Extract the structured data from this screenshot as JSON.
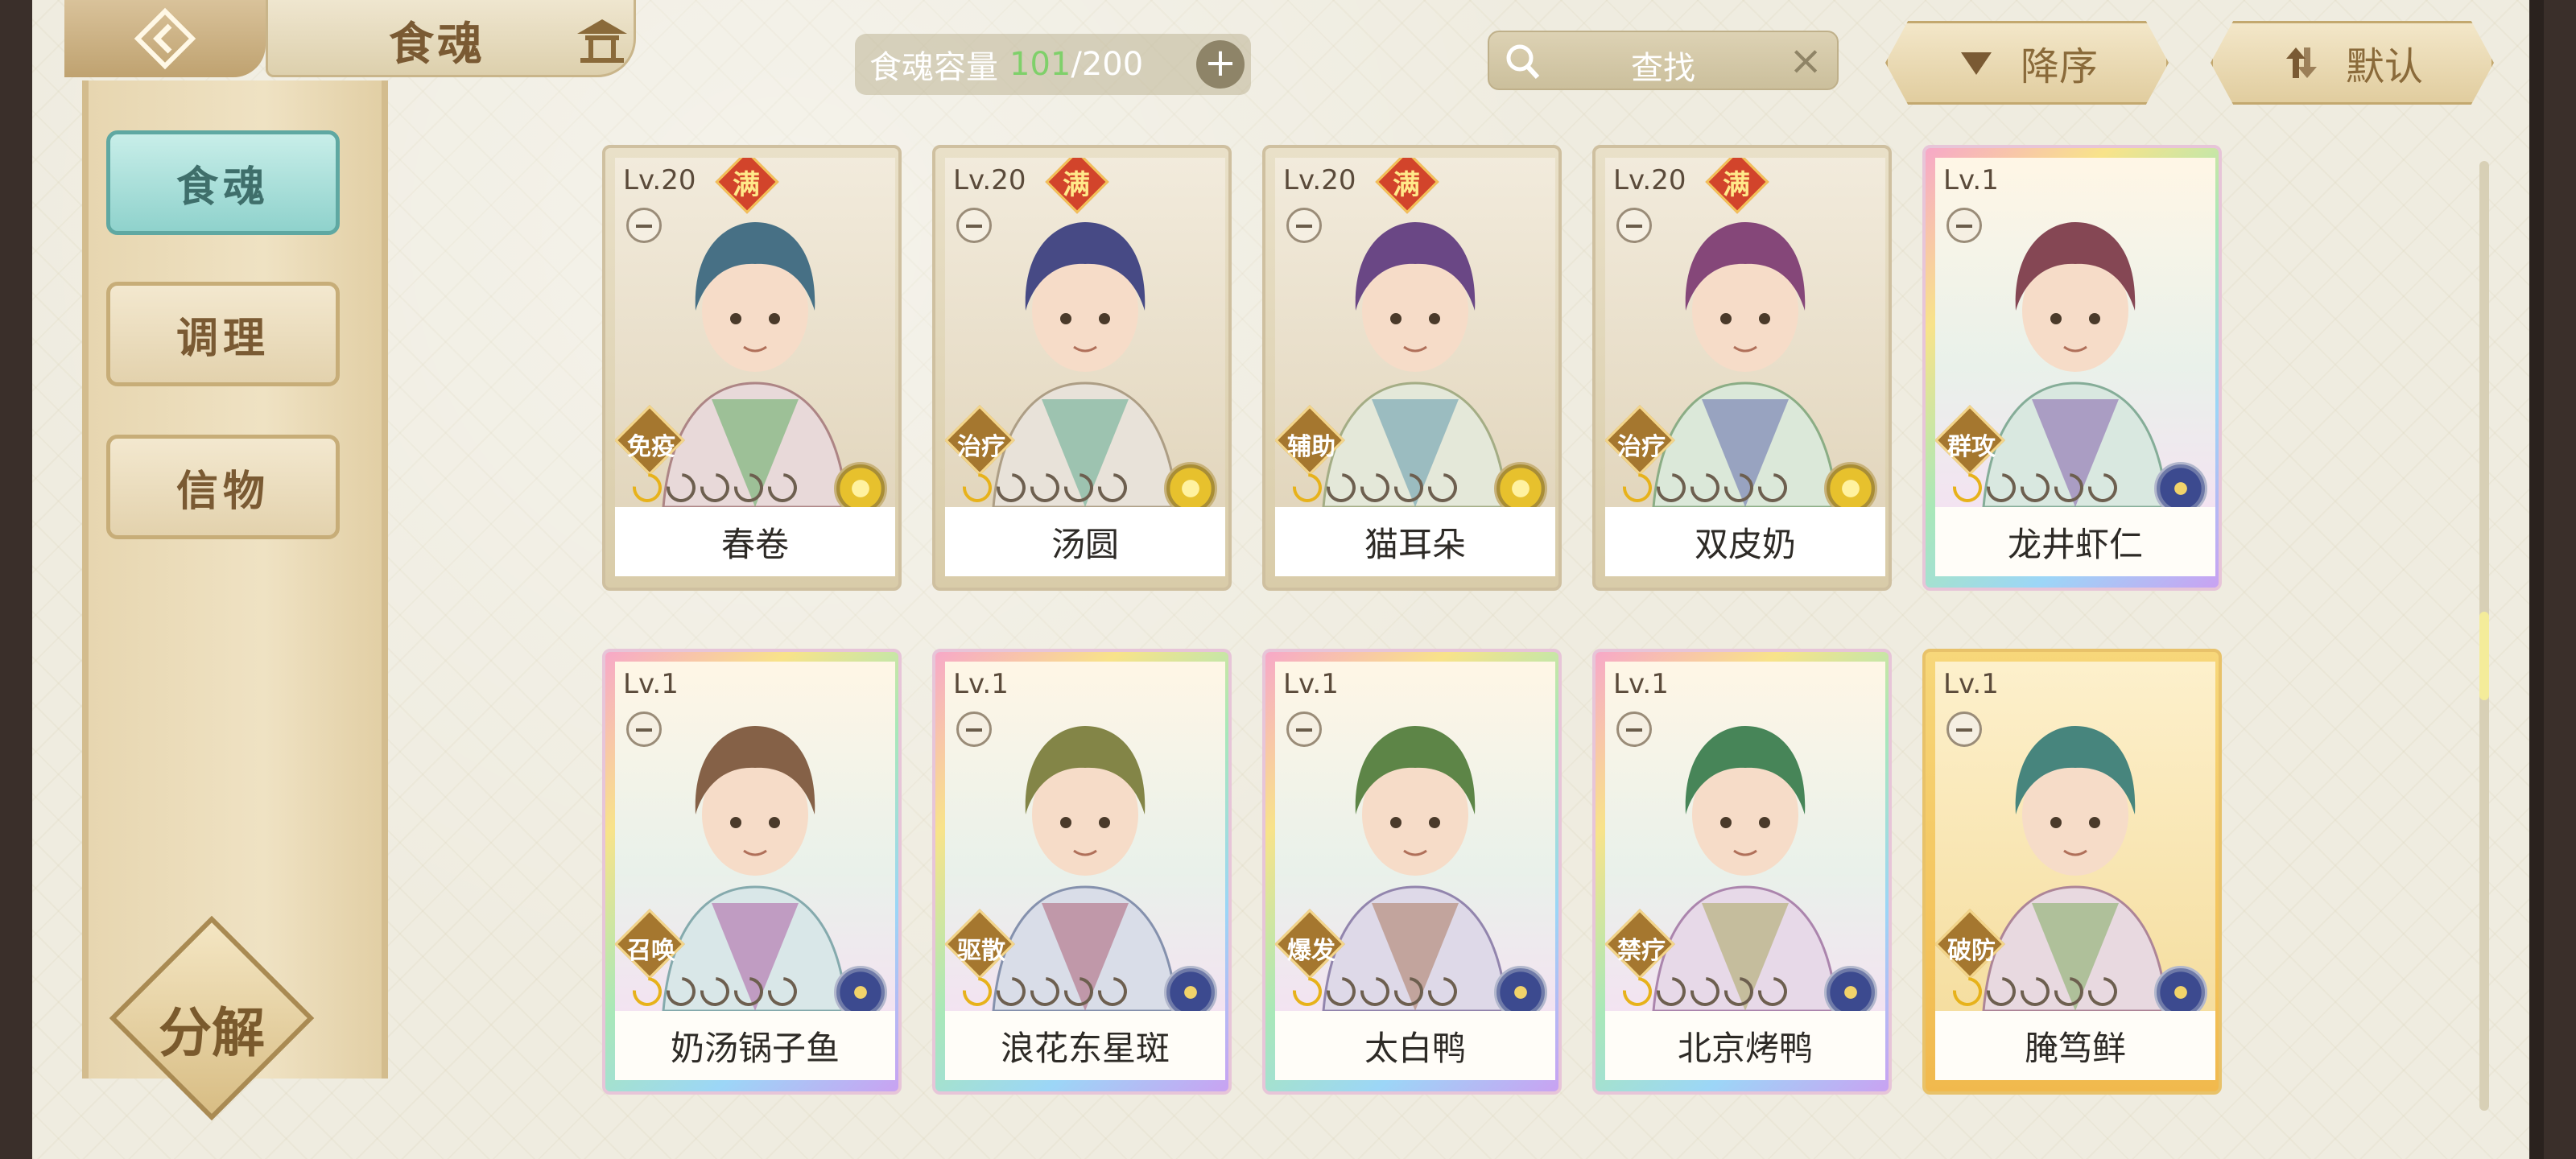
{
  "header": {
    "title": "食魂",
    "capacity_label": "食魂容量",
    "capacity_current": "101",
    "capacity_separator": "/",
    "capacity_max": "200",
    "search_label": "查找",
    "sort_order_label": "降序",
    "sort_mode_label": "默认"
  },
  "sidebar": {
    "items": [
      {
        "label": "食魂",
        "active": true
      },
      {
        "label": "调理",
        "active": false
      },
      {
        "label": "信物",
        "active": false
      }
    ],
    "decompose_label": "分解"
  },
  "cards": [
    {
      "level": "Lv.20",
      "full": "满",
      "role": "免疫",
      "name": "春卷",
      "frame": "gold",
      "flower": "yellow"
    },
    {
      "level": "Lv.20",
      "full": "满",
      "role": "治疗",
      "name": "汤圆",
      "frame": "gold",
      "flower": "yellow"
    },
    {
      "level": "Lv.20",
      "full": "满",
      "role": "辅助",
      "name": "猫耳朵",
      "frame": "gold",
      "flower": "yellow"
    },
    {
      "level": "Lv.20",
      "full": "满",
      "role": "治疗",
      "name": "双皮奶",
      "frame": "gold",
      "flower": "yellow"
    },
    {
      "level": "Lv.1",
      "full": "",
      "role": "群攻",
      "name": "龙井虾仁",
      "frame": "rainbow",
      "flower": "blue"
    },
    {
      "level": "Lv.1",
      "full": "",
      "role": "召唤",
      "name": "奶汤锅子鱼",
      "frame": "rainbow",
      "flower": "blue"
    },
    {
      "level": "Lv.1",
      "full": "",
      "role": "驱散",
      "name": "浪花东星斑",
      "frame": "rainbow",
      "flower": "blue"
    },
    {
      "level": "Lv.1",
      "full": "",
      "role": "爆发",
      "name": "太白鸭",
      "frame": "rainbow",
      "flower": "blue"
    },
    {
      "level": "Lv.1",
      "full": "",
      "role": "禁疗",
      "name": "北京烤鸭",
      "frame": "rainbow",
      "flower": "blue"
    },
    {
      "level": "Lv.1",
      "full": "",
      "role": "破防",
      "name": "腌笃鲜",
      "frame": "amber",
      "flower": "blue"
    }
  ],
  "colors": {
    "accent_teal": "#8fd2cc",
    "capacity_green": "#7fd06a",
    "gold_text": "#7a5a33"
  }
}
